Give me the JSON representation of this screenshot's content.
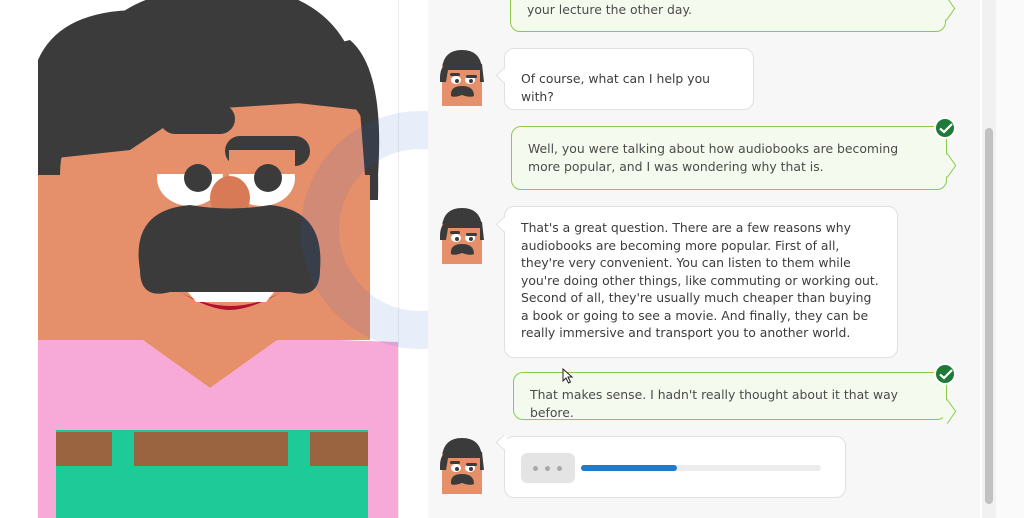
{
  "chat": {
    "messages": [
      {
        "role": "user",
        "text": "your lecture the other day.",
        "checked": false
      },
      {
        "role": "bot",
        "text": "Of course, what can I help you with?"
      },
      {
        "role": "user",
        "text": "Well, you were talking about how audiobooks are becoming more popular, and I was wondering why that is.",
        "checked": true
      },
      {
        "role": "bot",
        "text": "That's a great question. There are a few reasons why audiobooks are becoming more popular. First of all, they're very convenient. You can listen to them while you're doing other things, like commuting or working out. Second of all, they're usually much cheaper than buying a book or going to see a movie. And finally, they can be really immersive and transport you to another world."
      },
      {
        "role": "user",
        "text": "That makes sense. I hadn't really thought about it that way before.",
        "checked": true
      }
    ],
    "typing_progress": 0.4
  },
  "colors": {
    "user_bubble_border": "#8acb4a",
    "check_badge": "#1f7a3a",
    "progress": "#1f7acc"
  },
  "icons": {
    "check": "check-icon",
    "avatar": "character-avatar-icon"
  }
}
